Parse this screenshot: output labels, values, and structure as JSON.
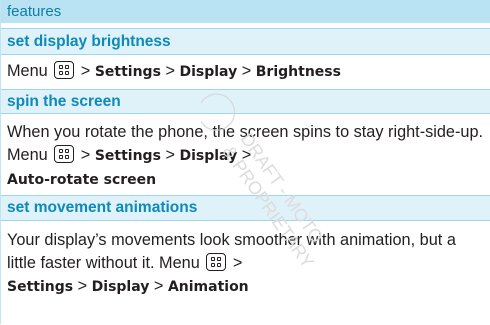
{
  "header": {
    "title": "features"
  },
  "sections": [
    {
      "title": "set display brightness",
      "menu": "Menu",
      "sep1": " > ",
      "item1": "Settings",
      "sep2": " > ",
      "item2": "Display",
      "sep3": " > ",
      "item3": "Brightness"
    },
    {
      "title": "spin the screen",
      "text": "When you rotate the phone, the screen spins to stay right-side-up. ",
      "menu": "Menu",
      "sep1": " > ",
      "item1": "Settings",
      "sep2": " > ",
      "item2": "Display",
      "sep3": " > ",
      "item3": "Auto-rotate screen"
    },
    {
      "title": "set movement animations",
      "text": "Your display’s movements look smoother with animation, but a little faster without it. ",
      "menu": "Menu",
      "sep1": " > ",
      "item1": "Settings",
      "sep2": " > ",
      "item2": "Display",
      "sep3": " > ",
      "item3": "Animation"
    }
  ],
  "icons": {
    "menu_key": "menu-key-icon"
  },
  "watermark": {
    "lines": [
      "DRAFT - MOTO",
      "& PROPRIETARY"
    ]
  },
  "colors": {
    "header_bg": "#b9e3f3",
    "header_text": "#0d7ea8",
    "section_bg": "#dff2fa",
    "section_text": "#0d8ab8",
    "body_text": "#231f20"
  }
}
